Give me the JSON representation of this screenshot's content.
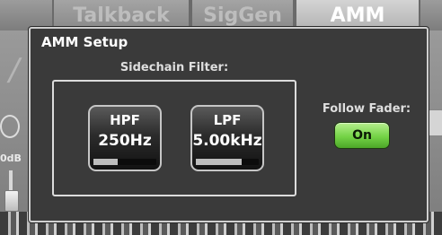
{
  "background": {
    "tabs": [
      {
        "label": "Talkback",
        "active": false
      },
      {
        "label": "SigGen",
        "active": false
      },
      {
        "label": "AMM",
        "active": true
      }
    ],
    "db_label": "0dB"
  },
  "dialog": {
    "title": "AMM Setup",
    "sidechain_label": "Sidechain Filter:",
    "hpf": {
      "label": "HPF",
      "value": "250Hz",
      "level": 0.38
    },
    "lpf": {
      "label": "LPF",
      "value": "5.00kHz",
      "level": 0.73
    },
    "follow_fader": {
      "label": "Follow Fader:",
      "button": "On",
      "state": "on"
    }
  },
  "colors": {
    "on_button": "#74d346",
    "dialog_bg": "#3a3a3a"
  }
}
